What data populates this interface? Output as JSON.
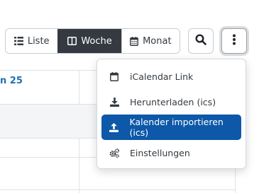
{
  "toolbar": {
    "views": [
      {
        "label": "Liste",
        "icon": "list-icon",
        "active": false
      },
      {
        "label": "Woche",
        "icon": "columns-icon",
        "active": true
      },
      {
        "label": "Monat",
        "icon": "calendar-grid-icon",
        "active": false
      }
    ],
    "search_icon": "search-icon",
    "more_icon": "vertical-ellipsis-icon"
  },
  "calendar": {
    "day_header": "n 25"
  },
  "menu": {
    "items": [
      {
        "label": "iCalendar Link",
        "icon": "calendar-icon"
      },
      {
        "label": "Herunterladen (ics)",
        "icon": "download-icon"
      },
      {
        "label": "Kalender importieren (ics)",
        "icon": "upload-icon",
        "active": true
      },
      {
        "label": "Einstellungen",
        "icon": "cogs-icon"
      }
    ]
  },
  "colors": {
    "active_view_bg": "#343a40",
    "active_menu_bg": "#0d58a8",
    "link": "#1f6fb2",
    "border": "#c8cdd2"
  }
}
